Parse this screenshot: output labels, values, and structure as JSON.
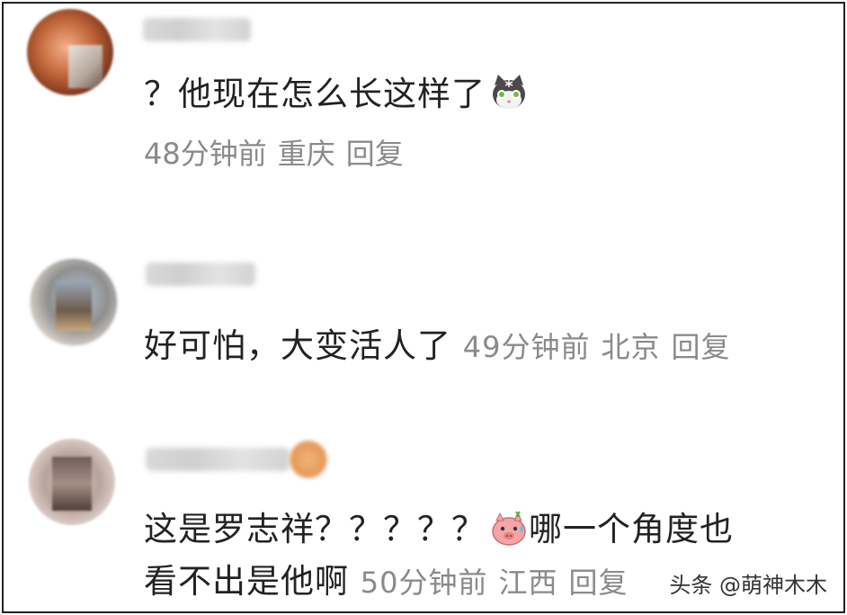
{
  "comments": [
    {
      "text": "？他现在怎么长这样了",
      "emoji": "cat-face-icon",
      "time": "48分钟前",
      "location": "重庆",
      "reply_label": "回复"
    },
    {
      "text": "好可怕，大变活人了",
      "time": "49分钟前",
      "location": "北京",
      "reply_label": "回复"
    },
    {
      "text_line1": "这是罗志祥？？？？？",
      "emoji": "sweating-pig-icon",
      "text_line1_after": "哪一个角度也",
      "text_line2": "看不出是他啊",
      "time": "50分钟前",
      "location": "江西",
      "reply_label": "回复"
    }
  ],
  "watermark": "头条 @萌神木木"
}
